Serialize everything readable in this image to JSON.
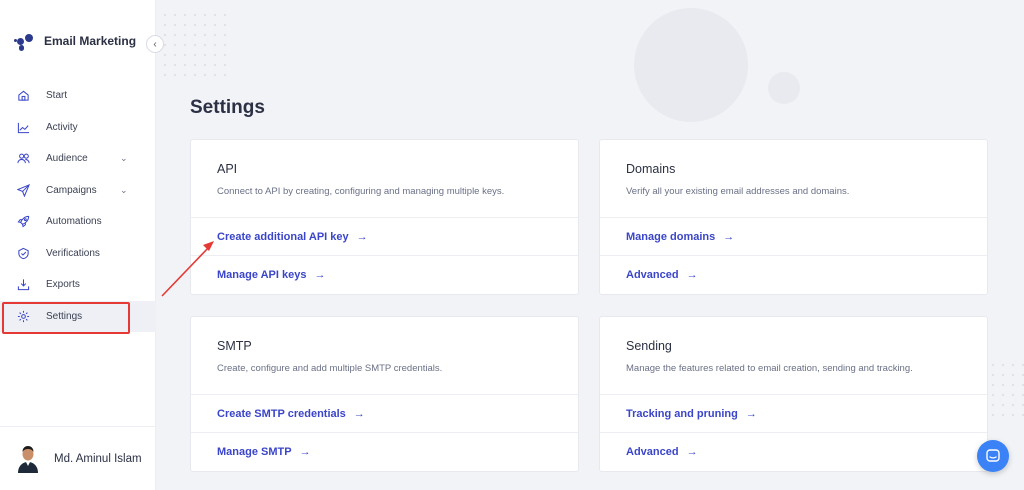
{
  "brand": {
    "name": "Email Marketing",
    "logo_color": "#2b3a8c"
  },
  "sidebar": {
    "collapse_icon": "chevron-left-icon",
    "items": [
      {
        "label": "Start",
        "icon": "home-icon",
        "has_chevron": false
      },
      {
        "label": "Activity",
        "icon": "chart-icon",
        "has_chevron": false
      },
      {
        "label": "Audience",
        "icon": "users-icon",
        "has_chevron": true
      },
      {
        "label": "Campaigns",
        "icon": "send-icon",
        "has_chevron": true
      },
      {
        "label": "Automations",
        "icon": "rocket-icon",
        "has_chevron": false
      },
      {
        "label": "Verifications",
        "icon": "shield-icon",
        "has_chevron": false
      },
      {
        "label": "Exports",
        "icon": "download-icon",
        "has_chevron": false
      },
      {
        "label": "Settings",
        "icon": "gear-icon",
        "has_chevron": false,
        "active": true
      }
    ]
  },
  "profile": {
    "name": "Md. Aminul Islam"
  },
  "page": {
    "title": "Settings"
  },
  "cards": {
    "api": {
      "title": "API",
      "description": "Connect to API by creating, configuring and managing multiple keys.",
      "links": [
        "Create additional API key",
        "Manage API keys"
      ]
    },
    "domains": {
      "title": "Domains",
      "description": "Verify all your existing email addresses and domains.",
      "links": [
        "Manage domains",
        "Advanced"
      ]
    },
    "smtp": {
      "title": "SMTP",
      "description": "Create, configure and add multiple SMTP credentials.",
      "links": [
        "Create SMTP credentials",
        "Manage SMTP"
      ]
    },
    "sending": {
      "title": "Sending",
      "description": "Manage the features related to email creation, sending and tracking.",
      "links": [
        "Tracking and pruning",
        "Advanced"
      ]
    }
  },
  "link_arrow": "→",
  "colors": {
    "accent": "#3a45c9",
    "highlight": "#e53935",
    "chat": "#3b82f6"
  }
}
